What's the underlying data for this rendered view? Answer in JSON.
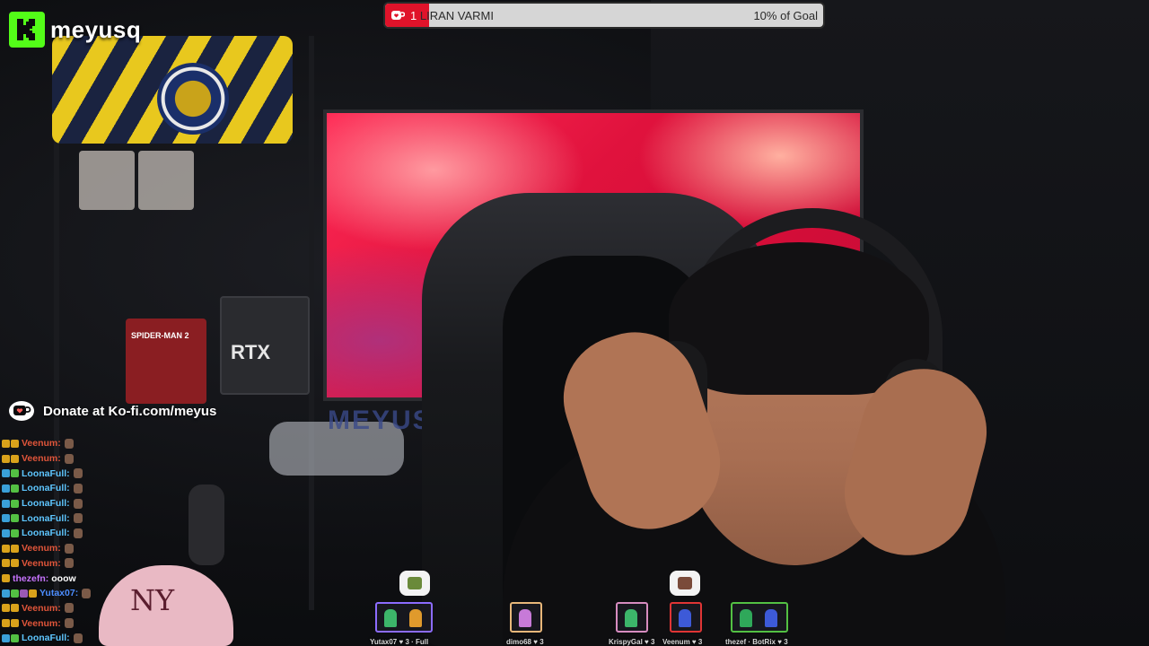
{
  "channel": {
    "name": "meyusq",
    "brand_color": "#53fc18"
  },
  "goal": {
    "count": "1",
    "title": "LIRAN VARMI",
    "progress_text": "10% of Goal",
    "progress_fraction": 0.1,
    "fill_color": "#e0132a"
  },
  "donate": {
    "text": "Donate at Ko-fi.com/meyus",
    "icon": "ko-fi-cup-icon"
  },
  "scene": {
    "desk_text": "MEYUS",
    "box_text_1": "RTX",
    "box_text_2": "SPIDER-MAN 2"
  },
  "chat": [
    {
      "user": "Veenum:",
      "color": "#e0553a",
      "badges": [
        "#d9a21b",
        "#d9a21b"
      ],
      "msg": "",
      "emote": true
    },
    {
      "user": "Veenum:",
      "color": "#e0553a",
      "badges": [
        "#d9a21b",
        "#d9a21b"
      ],
      "msg": "",
      "emote": true
    },
    {
      "user": "LoonaFull:",
      "color": "#5ec6ff",
      "badges": [
        "#3aa0d8",
        "#53c043"
      ],
      "msg": "",
      "emote": true
    },
    {
      "user": "LoonaFull:",
      "color": "#5ec6ff",
      "badges": [
        "#3aa0d8",
        "#53c043"
      ],
      "msg": "",
      "emote": true
    },
    {
      "user": "LoonaFull:",
      "color": "#5ec6ff",
      "badges": [
        "#3aa0d8",
        "#53c043"
      ],
      "msg": "",
      "emote": true
    },
    {
      "user": "LoonaFull:",
      "color": "#5ec6ff",
      "badges": [
        "#3aa0d8",
        "#53c043"
      ],
      "msg": "",
      "emote": true
    },
    {
      "user": "LoonaFull:",
      "color": "#5ec6ff",
      "badges": [
        "#3aa0d8",
        "#53c043"
      ],
      "msg": "",
      "emote": true
    },
    {
      "user": "Veenum:",
      "color": "#e0553a",
      "badges": [
        "#d9a21b",
        "#d9a21b"
      ],
      "msg": "",
      "emote": true
    },
    {
      "user": "Veenum:",
      "color": "#e0553a",
      "badges": [
        "#d9a21b",
        "#d9a21b"
      ],
      "msg": "",
      "emote": true
    },
    {
      "user": "thezefn:",
      "color": "#c874ff",
      "badges": [
        "#d9a21b"
      ],
      "msg": "ooow",
      "emote": false
    },
    {
      "user": "Yutax07:",
      "color": "#4c8dff",
      "badges": [
        "#3aa0d8",
        "#53c043",
        "#9b59b6",
        "#d9a21b"
      ],
      "msg": "",
      "emote": true
    },
    {
      "user": "Veenum:",
      "color": "#e0553a",
      "badges": [
        "#d9a21b",
        "#d9a21b"
      ],
      "msg": "",
      "emote": true
    },
    {
      "user": "Veenum:",
      "color": "#e0553a",
      "badges": [
        "#d9a21b",
        "#d9a21b"
      ],
      "msg": "",
      "emote": true
    },
    {
      "user": "LoonaFull:",
      "color": "#5ec6ff",
      "badges": [
        "#3aa0d8",
        "#53c043"
      ],
      "msg": "",
      "emote": true
    }
  ],
  "viewers": [
    {
      "label": "Yutax07 ♥ 3 · Full",
      "border": "#8c6cff",
      "figs": [
        "#3cb56a",
        "#e09a2c"
      ],
      "bubble": true,
      "bubble_color": "#6a8a3a"
    },
    {
      "label": "dimo68 ♥ 3",
      "border": "#e8b77a",
      "figs": [
        "#c77ad8"
      ],
      "bubble": false
    },
    {
      "label": "KrispyGal ♥ 3",
      "border": "#d78cc0",
      "figs": [
        "#3cb56a"
      ],
      "bubble": false
    },
    {
      "label": "Veenum ♥ 3",
      "border": "#e03535",
      "figs": [
        "#3d5ad8"
      ],
      "bubble": true,
      "bubble_color": "#7a4b3a"
    },
    {
      "label": "thezef · BotRix ♥ 3",
      "border": "#53c043",
      "figs": [
        "#2fa85a",
        "#3d5ad8"
      ],
      "bubble": false
    }
  ]
}
